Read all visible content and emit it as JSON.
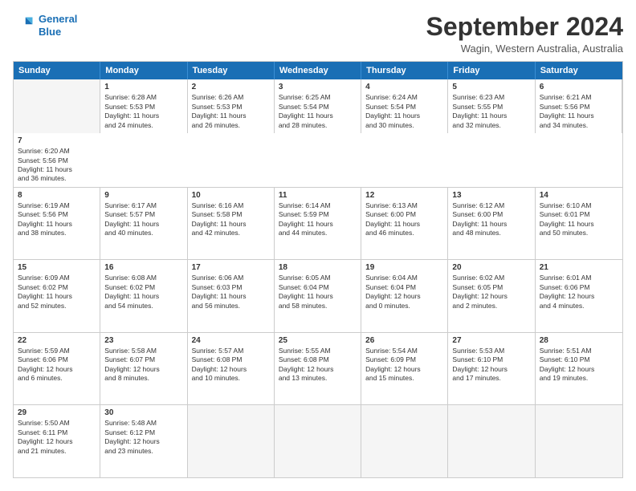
{
  "header": {
    "logo_line1": "General",
    "logo_line2": "Blue",
    "month": "September 2024",
    "location": "Wagin, Western Australia, Australia"
  },
  "days": [
    "Sunday",
    "Monday",
    "Tuesday",
    "Wednesday",
    "Thursday",
    "Friday",
    "Saturday"
  ],
  "rows": [
    [
      {
        "num": "",
        "empty": true
      },
      {
        "num": "1",
        "lines": [
          "Sunrise: 6:28 AM",
          "Sunset: 5:53 PM",
          "Daylight: 11 hours",
          "and 24 minutes."
        ]
      },
      {
        "num": "2",
        "lines": [
          "Sunrise: 6:26 AM",
          "Sunset: 5:53 PM",
          "Daylight: 11 hours",
          "and 26 minutes."
        ]
      },
      {
        "num": "3",
        "lines": [
          "Sunrise: 6:25 AM",
          "Sunset: 5:54 PM",
          "Daylight: 11 hours",
          "and 28 minutes."
        ]
      },
      {
        "num": "4",
        "lines": [
          "Sunrise: 6:24 AM",
          "Sunset: 5:54 PM",
          "Daylight: 11 hours",
          "and 30 minutes."
        ]
      },
      {
        "num": "5",
        "lines": [
          "Sunrise: 6:23 AM",
          "Sunset: 5:55 PM",
          "Daylight: 11 hours",
          "and 32 minutes."
        ]
      },
      {
        "num": "6",
        "lines": [
          "Sunrise: 6:21 AM",
          "Sunset: 5:56 PM",
          "Daylight: 11 hours",
          "and 34 minutes."
        ]
      },
      {
        "num": "7",
        "lines": [
          "Sunrise: 6:20 AM",
          "Sunset: 5:56 PM",
          "Daylight: 11 hours",
          "and 36 minutes."
        ]
      }
    ],
    [
      {
        "num": "8",
        "lines": [
          "Sunrise: 6:19 AM",
          "Sunset: 5:56 PM",
          "Daylight: 11 hours",
          "and 38 minutes."
        ]
      },
      {
        "num": "9",
        "lines": [
          "Sunrise: 6:17 AM",
          "Sunset: 5:57 PM",
          "Daylight: 11 hours",
          "and 40 minutes."
        ]
      },
      {
        "num": "10",
        "lines": [
          "Sunrise: 6:16 AM",
          "Sunset: 5:58 PM",
          "Daylight: 11 hours",
          "and 42 minutes."
        ]
      },
      {
        "num": "11",
        "lines": [
          "Sunrise: 6:14 AM",
          "Sunset: 5:59 PM",
          "Daylight: 11 hours",
          "and 44 minutes."
        ]
      },
      {
        "num": "12",
        "lines": [
          "Sunrise: 6:13 AM",
          "Sunset: 6:00 PM",
          "Daylight: 11 hours",
          "and 46 minutes."
        ]
      },
      {
        "num": "13",
        "lines": [
          "Sunrise: 6:12 AM",
          "Sunset: 6:00 PM",
          "Daylight: 11 hours",
          "and 48 minutes."
        ]
      },
      {
        "num": "14",
        "lines": [
          "Sunrise: 6:10 AM",
          "Sunset: 6:01 PM",
          "Daylight: 11 hours",
          "and 50 minutes."
        ]
      }
    ],
    [
      {
        "num": "15",
        "lines": [
          "Sunrise: 6:09 AM",
          "Sunset: 6:02 PM",
          "Daylight: 11 hours",
          "and 52 minutes."
        ]
      },
      {
        "num": "16",
        "lines": [
          "Sunrise: 6:08 AM",
          "Sunset: 6:02 PM",
          "Daylight: 11 hours",
          "and 54 minutes."
        ]
      },
      {
        "num": "17",
        "lines": [
          "Sunrise: 6:06 AM",
          "Sunset: 6:03 PM",
          "Daylight: 11 hours",
          "and 56 minutes."
        ]
      },
      {
        "num": "18",
        "lines": [
          "Sunrise: 6:05 AM",
          "Sunset: 6:04 PM",
          "Daylight: 11 hours",
          "and 58 minutes."
        ]
      },
      {
        "num": "19",
        "lines": [
          "Sunrise: 6:04 AM",
          "Sunset: 6:04 PM",
          "Daylight: 12 hours",
          "and 0 minutes."
        ]
      },
      {
        "num": "20",
        "lines": [
          "Sunrise: 6:02 AM",
          "Sunset: 6:05 PM",
          "Daylight: 12 hours",
          "and 2 minutes."
        ]
      },
      {
        "num": "21",
        "lines": [
          "Sunrise: 6:01 AM",
          "Sunset: 6:06 PM",
          "Daylight: 12 hours",
          "and 4 minutes."
        ]
      }
    ],
    [
      {
        "num": "22",
        "lines": [
          "Sunrise: 5:59 AM",
          "Sunset: 6:06 PM",
          "Daylight: 12 hours",
          "and 6 minutes."
        ]
      },
      {
        "num": "23",
        "lines": [
          "Sunrise: 5:58 AM",
          "Sunset: 6:07 PM",
          "Daylight: 12 hours",
          "and 8 minutes."
        ]
      },
      {
        "num": "24",
        "lines": [
          "Sunrise: 5:57 AM",
          "Sunset: 6:08 PM",
          "Daylight: 12 hours",
          "and 10 minutes."
        ]
      },
      {
        "num": "25",
        "lines": [
          "Sunrise: 5:55 AM",
          "Sunset: 6:08 PM",
          "Daylight: 12 hours",
          "and 13 minutes."
        ]
      },
      {
        "num": "26",
        "lines": [
          "Sunrise: 5:54 AM",
          "Sunset: 6:09 PM",
          "Daylight: 12 hours",
          "and 15 minutes."
        ]
      },
      {
        "num": "27",
        "lines": [
          "Sunrise: 5:53 AM",
          "Sunset: 6:10 PM",
          "Daylight: 12 hours",
          "and 17 minutes."
        ]
      },
      {
        "num": "28",
        "lines": [
          "Sunrise: 5:51 AM",
          "Sunset: 6:10 PM",
          "Daylight: 12 hours",
          "and 19 minutes."
        ]
      }
    ],
    [
      {
        "num": "29",
        "lines": [
          "Sunrise: 5:50 AM",
          "Sunset: 6:11 PM",
          "Daylight: 12 hours",
          "and 21 minutes."
        ]
      },
      {
        "num": "30",
        "lines": [
          "Sunrise: 5:48 AM",
          "Sunset: 6:12 PM",
          "Daylight: 12 hours",
          "and 23 minutes."
        ]
      },
      {
        "num": "",
        "empty": true
      },
      {
        "num": "",
        "empty": true
      },
      {
        "num": "",
        "empty": true
      },
      {
        "num": "",
        "empty": true
      },
      {
        "num": "",
        "empty": true
      }
    ]
  ]
}
